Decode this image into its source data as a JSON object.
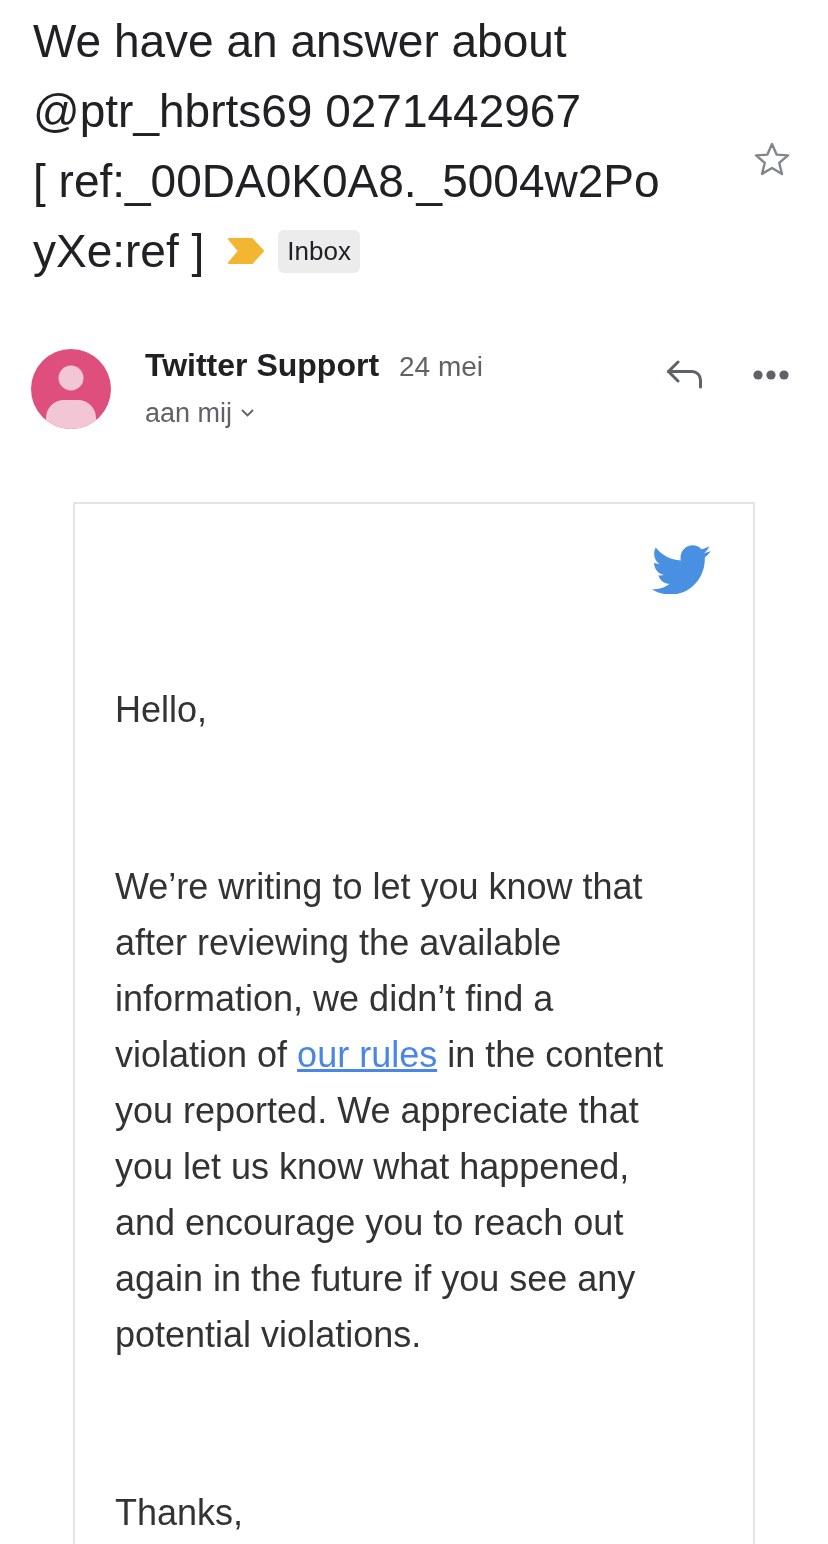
{
  "subject": {
    "title_lines": [
      "We have an answer about",
      "@ptr_hbrts69 0271442967",
      "[ ref:_00DA0K0A8._5004w2Po",
      "yXe:ref ]"
    ],
    "important": true,
    "label": "Inbox",
    "starred": false
  },
  "message": {
    "sender": "Twitter Support",
    "date": "24 mei",
    "recipient": "aan mij"
  },
  "email_body": {
    "greeting": "Hello,",
    "paragraph": {
      "text_before": "We’re writing to let you know that after reviewing the available information, we didn’t find a violation of ",
      "link": "our rules",
      "text_after": " in the content you reported. We appreciate that you let us know what happened, and encourage you to reach out again in the future if you see any potential violations."
    },
    "closing": "Thanks,"
  }
}
